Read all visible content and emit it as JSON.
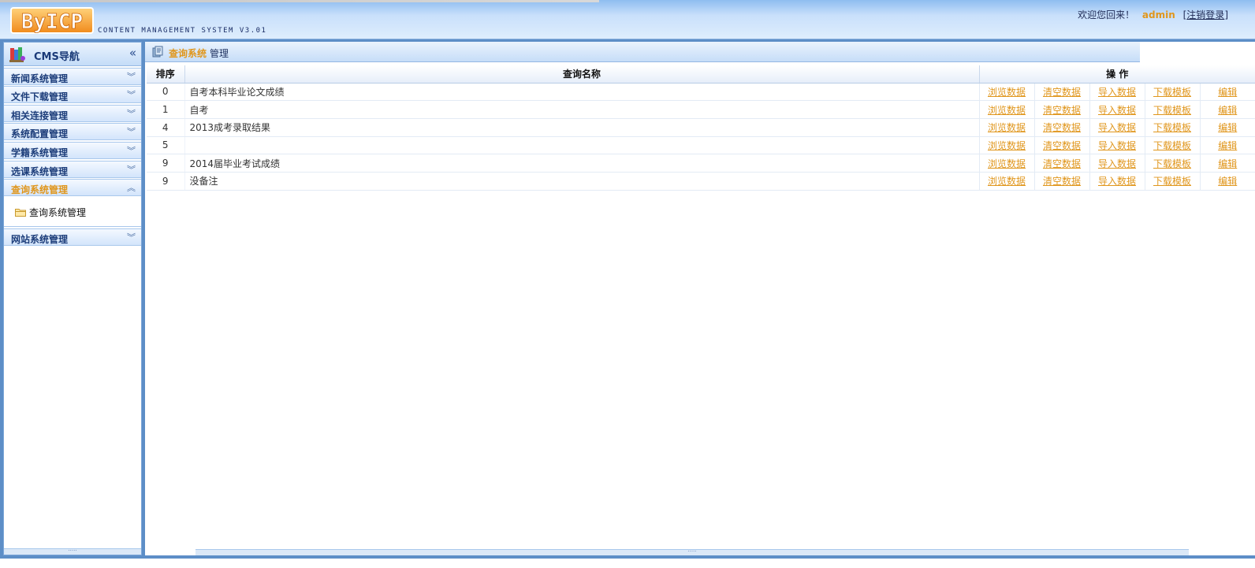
{
  "header": {
    "logo_text": "ByICP",
    "tagline": "CONTENT MANAGEMENT SYSTEM V3.01",
    "welcome": "欢迎您回来！",
    "username": "admin",
    "logout": "注销登录"
  },
  "sidebar": {
    "title": "CMS导航",
    "collapse_glyph": "«",
    "items": [
      {
        "label": "新闻系统管理"
      },
      {
        "label": "文件下载管理"
      },
      {
        "label": "相关连接管理"
      },
      {
        "label": "系统配置管理"
      },
      {
        "label": "学籍系统管理"
      },
      {
        "label": "选课系统管理"
      },
      {
        "label": "查询系统管理",
        "active": true,
        "children": [
          {
            "label": "查询系统管理"
          }
        ]
      },
      {
        "label": "网站系统管理"
      }
    ]
  },
  "breadcrumb": {
    "highlight": "查询系统",
    "rest": "管理"
  },
  "table": {
    "columns": {
      "order": "排序",
      "name": "查询名称",
      "ops": "操 作"
    },
    "actions": [
      "浏览数据",
      "清空数据",
      "导入数据",
      "下载模板",
      "编辑"
    ],
    "rows": [
      {
        "order": "0",
        "name": "自考本科毕业论文成绩"
      },
      {
        "order": "1",
        "name": "自考"
      },
      {
        "order": "4",
        "name": "2013成考录取结果"
      },
      {
        "order": "5",
        "name": ""
      },
      {
        "order": "9",
        "name": "2014届毕业考试成绩"
      },
      {
        "order": "9",
        "name": "没备注"
      }
    ]
  },
  "colors": {
    "accent": "#e0961c",
    "nav_text": "#1c3d7a",
    "frame": "#5d8ec7"
  },
  "icons": [
    "cms-books-icon",
    "collapse-left-icon",
    "chevron-down-icon",
    "chevron-up-icon",
    "folder-icon",
    "crumb-icon",
    "splitter-grip-icon"
  ]
}
